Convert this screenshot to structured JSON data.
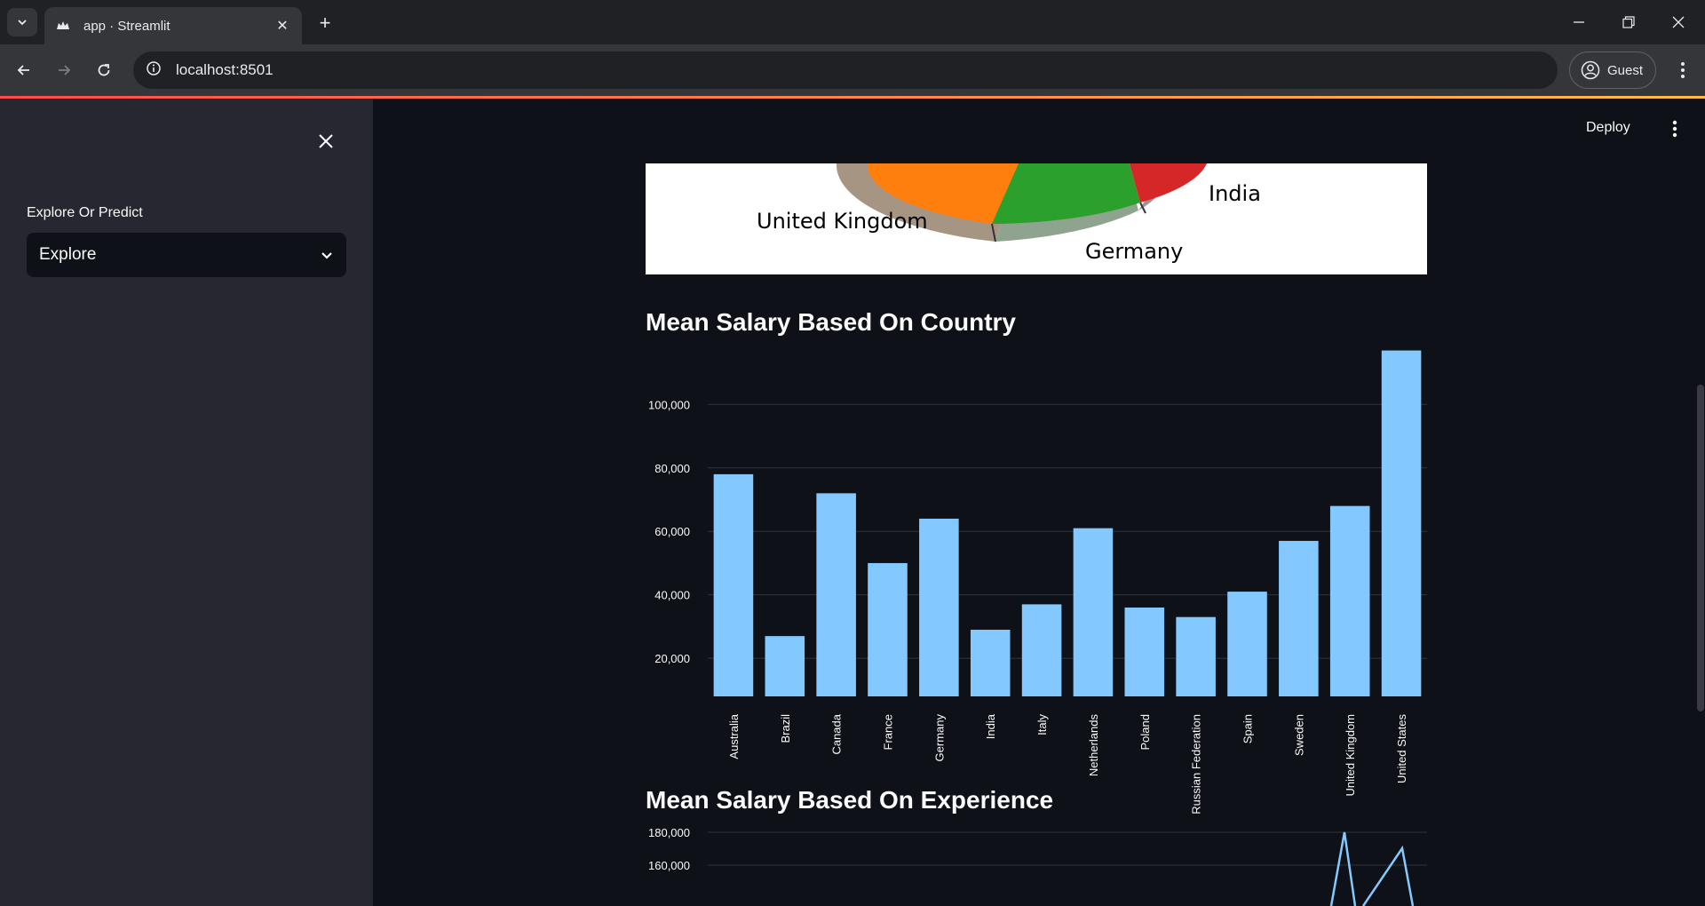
{
  "browser": {
    "tab_title": "app · Streamlit",
    "url": "localhost:8501",
    "profile_label": "Guest"
  },
  "app": {
    "deploy_label": "Deploy",
    "sidebar": {
      "select_label": "Explore Or Predict",
      "select_value": "Explore"
    }
  },
  "pie_image": {
    "labels": [
      "United Kingdom",
      "India",
      "Germany"
    ]
  },
  "sections": {
    "country_title": "Mean Salary Based On Country",
    "experience_title": "Mean Salary Based On Experience"
  },
  "colors": {
    "bar": "#83c9ff",
    "accent_start": "#ff4b4b",
    "accent_end": "#ffbd45"
  },
  "chart_data": [
    {
      "type": "bar",
      "categories": [
        "Australia",
        "Brazil",
        "Canada",
        "France",
        "Germany",
        "India",
        "Italy",
        "Netherlands",
        "Poland",
        "Russian Federation",
        "Spain",
        "Sweden",
        "United Kingdom",
        "United States"
      ],
      "values": [
        78000,
        27000,
        72000,
        50000,
        64000,
        29000,
        37000,
        61000,
        36000,
        33000,
        41000,
        57000,
        68000,
        117000
      ],
      "yticks": [
        20000,
        40000,
        60000,
        80000,
        100000
      ],
      "ytick_labels": [
        "20,000",
        "40,000",
        "60,000",
        "80,000",
        "100,000"
      ],
      "ylim": [
        8000,
        118000
      ],
      "grid": true
    },
    {
      "type": "line",
      "yticks": [
        160000,
        180000
      ],
      "ytick_labels": [
        "160,000",
        "180,000"
      ],
      "ylim": [
        120000,
        180000
      ],
      "grid": true
    }
  ]
}
